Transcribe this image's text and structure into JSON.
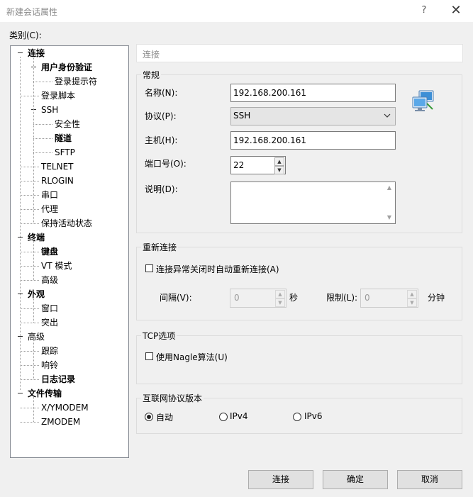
{
  "window": {
    "title": "新建会话属性",
    "help_glyph": "?",
    "close_glyph": "✕"
  },
  "category_label": "类别(C):",
  "tree": [
    {
      "label": "连接",
      "bold": true,
      "level": 0,
      "expand": true
    },
    {
      "label": "用户身份验证",
      "bold": true,
      "level": 1,
      "expand": true
    },
    {
      "label": "登录提示符",
      "bold": false,
      "level": 2
    },
    {
      "label": "登录脚本",
      "bold": false,
      "level": 1
    },
    {
      "label": "SSH",
      "bold": false,
      "level": 1,
      "expand": true
    },
    {
      "label": "安全性",
      "bold": false,
      "level": 2
    },
    {
      "label": "隧道",
      "bold": true,
      "level": 2
    },
    {
      "label": "SFTP",
      "bold": false,
      "level": 2
    },
    {
      "label": "TELNET",
      "bold": false,
      "level": 1
    },
    {
      "label": "RLOGIN",
      "bold": false,
      "level": 1
    },
    {
      "label": "串口",
      "bold": false,
      "level": 1
    },
    {
      "label": "代理",
      "bold": false,
      "level": 1
    },
    {
      "label": "保持活动状态",
      "bold": false,
      "level": 1
    },
    {
      "label": "终端",
      "bold": true,
      "level": 0,
      "expand": true
    },
    {
      "label": "键盘",
      "bold": true,
      "level": 1
    },
    {
      "label": "VT 模式",
      "bold": false,
      "level": 1
    },
    {
      "label": "高级",
      "bold": false,
      "level": 1
    },
    {
      "label": "外观",
      "bold": true,
      "level": 0,
      "expand": true
    },
    {
      "label": "窗口",
      "bold": false,
      "level": 1
    },
    {
      "label": "突出",
      "bold": false,
      "level": 1
    },
    {
      "label": "高级",
      "bold": false,
      "level": 0,
      "expand": true
    },
    {
      "label": "跟踪",
      "bold": false,
      "level": 1
    },
    {
      "label": "响铃",
      "bold": false,
      "level": 1
    },
    {
      "label": "日志记录",
      "bold": true,
      "level": 1
    },
    {
      "label": "文件传输",
      "bold": true,
      "level": 0,
      "expand": true
    },
    {
      "label": "X/YMODEM",
      "bold": false,
      "level": 1
    },
    {
      "label": "ZMODEM",
      "bold": false,
      "level": 1
    }
  ],
  "page_header": "连接",
  "general": {
    "title": "常规",
    "name_label": "名称(N):",
    "name_value": "192.168.200.161",
    "protocol_label": "协议(P):",
    "protocol_value": "SSH",
    "host_label": "主机(H):",
    "host_value": "192.168.200.161",
    "port_label": "端口号(O):",
    "port_value": "22",
    "desc_label": "说明(D):",
    "desc_value": ""
  },
  "reconnect": {
    "title": "重新连接",
    "checkbox_label": "连接异常关闭时自动重新连接(A)",
    "interval_label": "间隔(V):",
    "interval_value": "0",
    "interval_unit": "秒",
    "limit_label": "限制(L):",
    "limit_value": "0",
    "limit_unit": "分钟"
  },
  "tcp": {
    "title": "TCP选项",
    "nagle_label": "使用Nagle算法(U)"
  },
  "ip_version": {
    "title": "互联网协议版本",
    "options": [
      "自动",
      "IPv4",
      "IPv6"
    ],
    "selected": "自动"
  },
  "buttons": {
    "connect": "连接",
    "ok": "确定",
    "cancel": "取消"
  },
  "icons": {
    "network": "network-computers-icon"
  },
  "colors": {
    "background": "#f0f0f0",
    "border": "#828790",
    "disabled_text": "#9a9a9a"
  }
}
